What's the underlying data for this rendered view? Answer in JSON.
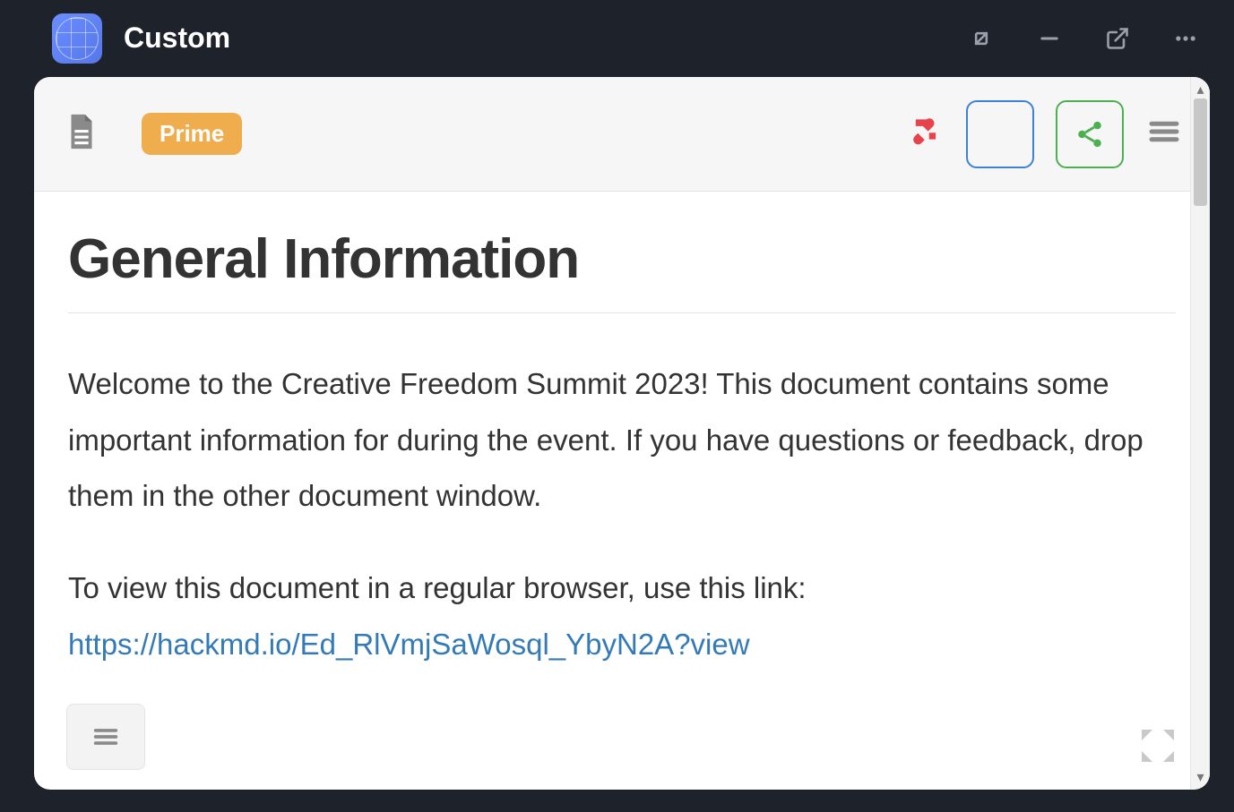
{
  "window": {
    "title": "Custom"
  },
  "toolbar": {
    "prime_label": "Prime"
  },
  "document": {
    "heading": "General Information",
    "paragraph1": "Welcome to the Creative Freedom Summit 2023! This document contains some important information for during the event. If you have questions or feedback, drop them in the other document window.",
    "paragraph2_prefix": "To view this document in a regular browser, use this link:",
    "link_text": "https://hackmd.io/Ed_RlVmjSaWosql_YbyN2A?view"
  }
}
